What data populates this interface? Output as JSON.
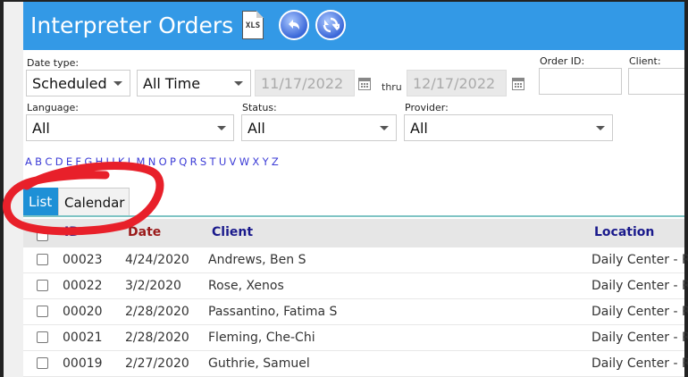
{
  "header": {
    "title": "Interpreter Orders",
    "xls_label": "XLS"
  },
  "filters": {
    "date_type_label": "Date type:",
    "date_type_value": "Scheduled",
    "range_value": "All Time",
    "date_from": "11/17/2022",
    "thru_label": "thru",
    "date_to": "12/17/2022",
    "order_id_label": "Order ID:",
    "client_label": "Client:",
    "language_label": "Language:",
    "language_value": "All",
    "status_label": "Status:",
    "status_value": "All",
    "provider_label": "Provider:",
    "provider_value": "All"
  },
  "alphabet": [
    "A",
    "B",
    "C",
    "D",
    "E",
    "F",
    "G",
    "H",
    "I",
    "J",
    "K",
    "L",
    "M",
    "N",
    "O",
    "P",
    "Q",
    "R",
    "S",
    "T",
    "U",
    "V",
    "W",
    "X",
    "Y",
    "Z"
  ],
  "tabs": {
    "list": "List",
    "calendar": "Calendar"
  },
  "table": {
    "columns": {
      "id": "ID",
      "date": "Date",
      "client": "Client",
      "location": "Location"
    },
    "rows": [
      {
        "id": "00023",
        "date": "4/24/2020",
        "client": "Andrews, Ben S",
        "location": "Daily Center - R"
      },
      {
        "id": "00022",
        "date": "3/2/2020",
        "client": "Rose, Xenos",
        "location": "Daily Center - R"
      },
      {
        "id": "00020",
        "date": "2/28/2020",
        "client": "Passantino, Fatima S",
        "location": "Daily Center - R"
      },
      {
        "id": "00021",
        "date": "2/28/2020",
        "client": "Fleming, Che-Chi",
        "location": "Daily Center - R"
      },
      {
        "id": "00019",
        "date": "2/27/2020",
        "client": "Guthrie, Samuel",
        "location": "Daily Center - R"
      }
    ]
  },
  "colors": {
    "header": "#3399e6",
    "tab_active": "#1e90d6",
    "id_header": "#1a1a8c",
    "date_header": "#9a1a1a",
    "annotation": "#e8202a"
  }
}
